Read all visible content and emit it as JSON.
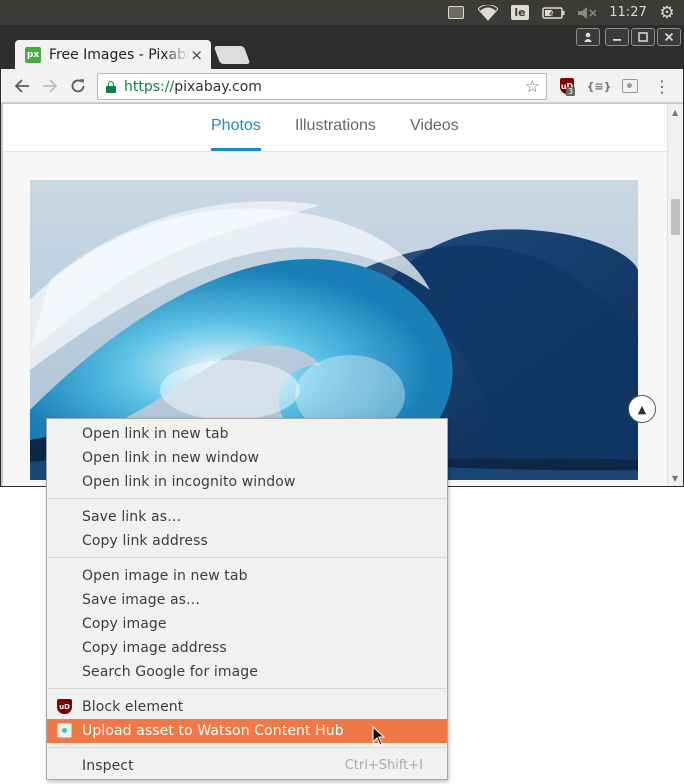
{
  "system_panel": {
    "keyboard_layout": "le",
    "clock": "11:27",
    "icons": [
      "inbox-icon",
      "wifi-icon",
      "keyboard-layout-indicator",
      "battery-icon",
      "volume-muted-icon",
      "settings-gear-icon"
    ]
  },
  "browser": {
    "tab": {
      "favicon_text": "px",
      "title": "Free Images - Pixabay",
      "close_glyph": "×"
    },
    "window_controls": [
      "user-button",
      "minimize-button",
      "maximize-button",
      "close-button"
    ],
    "toolbar": {
      "url_scheme": "https://",
      "url_host": "pixabay.com",
      "extensions": [
        {
          "name": "uBlock Origin",
          "icon_text": "uD",
          "badge": "3"
        },
        {
          "name": "JSON viewer",
          "icon_text": "{≡}"
        },
        {
          "name": "Watson Content Hub"
        }
      ]
    },
    "page": {
      "nav_tabs": [
        "Photos",
        "Illustrations",
        "Videos"
      ],
      "active_tab": "Photos",
      "accent_color": "#1e88c8",
      "image_subject": "ocean wave",
      "scroll_top_glyph": "▲"
    }
  },
  "context_menu": {
    "groups": [
      [
        "Open link in new tab",
        "Open link in new window",
        "Open link in incognito window"
      ],
      [
        "Save link as…",
        "Copy link address"
      ],
      [
        "Open image in new tab",
        "Save image as…",
        "Copy image",
        "Copy image address",
        "Search Google for image"
      ],
      [
        "Block element",
        "Upload asset to Watson Content Hub"
      ],
      [
        "Inspect"
      ]
    ],
    "block_icon_text": "uD",
    "highlighted_item": "Upload asset to Watson Content Hub",
    "highlight_color": "#f07746",
    "inspect_shortcut": "Ctrl+Shift+I"
  }
}
